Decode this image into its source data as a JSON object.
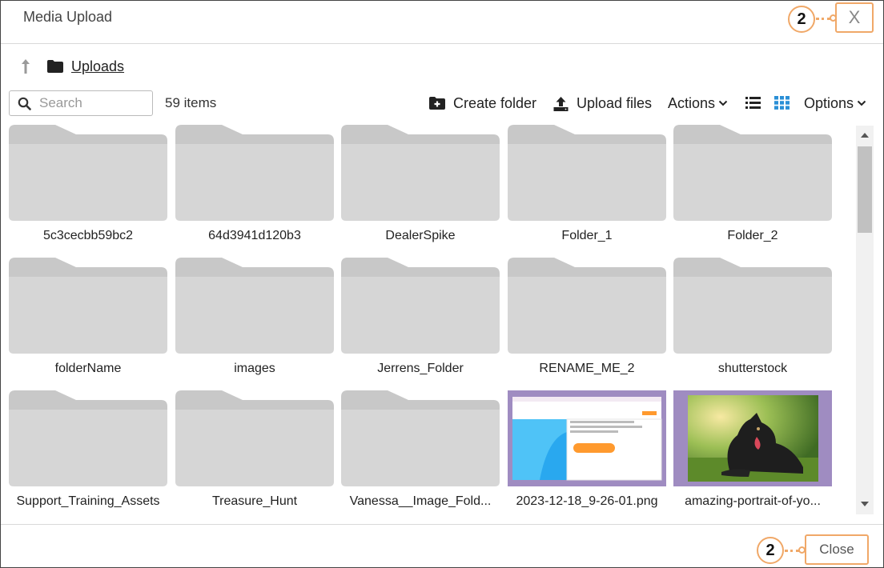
{
  "dialog": {
    "title": "Media Upload",
    "close_x": "X",
    "close_label": "Close",
    "callout_top": "2",
    "callout_bottom": "2"
  },
  "breadcrumb": {
    "up_icon": "arrow-up-icon",
    "folder_icon": "folder-icon",
    "current": "Uploads"
  },
  "toolbar": {
    "search_placeholder": "Search",
    "item_count": "59 items",
    "create_folder": "Create folder",
    "upload_files": "Upload files",
    "actions": "Actions",
    "options": "Options",
    "list_view_icon": "list-view-icon",
    "grid_view_icon": "grid-view-icon"
  },
  "items": [
    {
      "label": "5c3cecbb59bc2",
      "kind": "folder"
    },
    {
      "label": "64d3941d120b3",
      "kind": "folder"
    },
    {
      "label": "DealerSpike",
      "kind": "folder"
    },
    {
      "label": "Folder_1",
      "kind": "folder"
    },
    {
      "label": "Folder_2",
      "kind": "folder"
    },
    {
      "label": "folderName",
      "kind": "folder"
    },
    {
      "label": "images",
      "kind": "folder"
    },
    {
      "label": "Jerrens_Folder",
      "kind": "folder"
    },
    {
      "label": "RENAME_ME_2",
      "kind": "folder"
    },
    {
      "label": "shutterstock",
      "kind": "folder"
    },
    {
      "label": "Support_Training_Assets",
      "kind": "folder"
    },
    {
      "label": "Treasure_Hunt",
      "kind": "folder"
    },
    {
      "label": "Vanessa__Image_Fold...",
      "kind": "folder"
    },
    {
      "label": "2023-12-18_9-26-01.png",
      "kind": "image-screenshot"
    },
    {
      "label": "amazing-portrait-of-yo...",
      "kind": "image-dog"
    }
  ],
  "colors": {
    "accent": "#f0a868",
    "folder": "#d6d6d6",
    "folder_tab": "#c8c8c8",
    "thumb_border": "#9f8cc1",
    "grid_icon": "#2a8fd6"
  }
}
